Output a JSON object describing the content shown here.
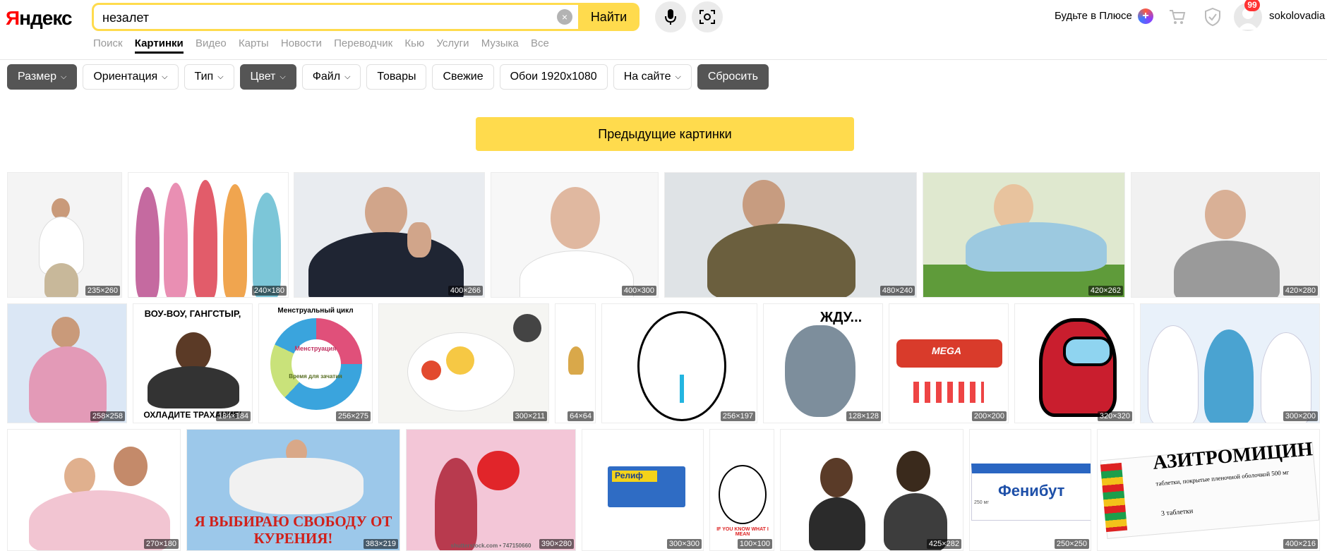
{
  "logo": {
    "first": "Я",
    "rest": "ндекс"
  },
  "search": {
    "value": "незалет",
    "button": "Найти",
    "clear": "×"
  },
  "nav": [
    "Поиск",
    "Картинки",
    "Видео",
    "Карты",
    "Новости",
    "Переводчик",
    "Кью",
    "Услуги",
    "Музыка",
    "Все"
  ],
  "header_right": {
    "plus": "Будьте в Плюсе",
    "badge": "99",
    "username": "sokolovadia"
  },
  "filters": [
    "Размер",
    "Ориентация",
    "Тип",
    "Цвет",
    "Файл",
    "Товары",
    "Свежие",
    "Обои 1920x1080",
    "На сайте",
    "Сбросить"
  ],
  "prev_button": "Предыдущие картинки",
  "images": {
    "row1": [
      "235×260",
      "240×180",
      "400×266",
      "400×300",
      "480×240",
      "420×262",
      "420×280"
    ],
    "row2": [
      "258×258",
      "184×184",
      "256×275",
      "300×211",
      "64×64",
      "256×197",
      "128×128",
      "200×200",
      "320×320",
      "300×200"
    ],
    "row3": [
      "270×180",
      "383×219",
      "390×280",
      "300×300",
      "100×100",
      "425×282",
      "250×250",
      "400×216"
    ]
  },
  "image_text": {
    "gangster_top": "ВОУ-ВОУ, ГАНГСТЫР,",
    "gangster_bottom": "ОХЛАДИТЕ ТРАХАНИЕ!",
    "cycle_title": "Менструальный цикл",
    "cycle_inner": "Менструация",
    "cycle_fertile": "Время для зачатия",
    "meme_wait": "ЖДУ...",
    "blaster": "MEGA",
    "freedom": "Я ВЫБИРАЮ СВОБОДУ ОТ КУРЕНИЯ!",
    "relief": "Релиф",
    "meme_small": "IF YOU KNOW WHAT I MEAN",
    "phenibut": "Фенибут",
    "phenibut_sub": "250 мг",
    "azithro": "АЗИТРОМИЦИН",
    "azithro_sub": "таблетки, покрытые пленочной оболочкой 500 мг",
    "azithro_count": "3 таблетки",
    "shutterstock": "shutterstock.com • 747150660"
  }
}
